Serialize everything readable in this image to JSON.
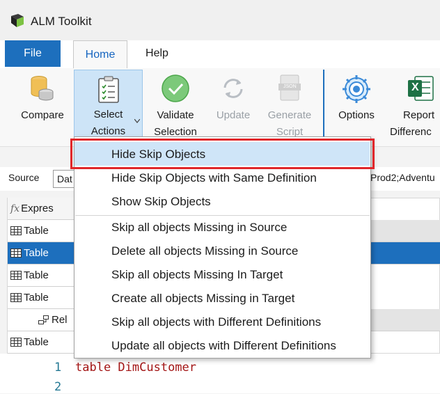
{
  "window": {
    "title": "ALM Toolkit"
  },
  "tabs": {
    "file": "File",
    "home": "Home",
    "help": "Help"
  },
  "ribbon": {
    "compare": "Compare",
    "select_actions_line1": "Select",
    "select_actions_line2": "Actions",
    "validate_line1": "Validate",
    "validate_line2": "Selection",
    "update": "Update",
    "generate_line1": "Generate",
    "generate_line2": "Script",
    "options": "Options",
    "report_line1": "Report",
    "report_line2": "Differenc",
    "json_icon_text": "JSON",
    "excel_icon_text": "X"
  },
  "source": {
    "label": "Source",
    "value": "Dat",
    "target_value": "Prod2;Adventu"
  },
  "grid": {
    "rows": [
      {
        "text": "Expres",
        "icon": "fx-icon",
        "selected": false
      },
      {
        "text": "Table",
        "icon": "table-icon",
        "selected": false
      },
      {
        "text": "Table",
        "icon": "table-icon",
        "selected": true
      },
      {
        "text": "Table",
        "icon": "table-icon",
        "selected": false
      },
      {
        "text": "Table",
        "icon": "table-icon",
        "selected": false
      },
      {
        "text": "Rel",
        "icon": "relationship-icon",
        "selected": false
      },
      {
        "text": "Table",
        "icon": "table-icon",
        "selected": false
      }
    ],
    "fx_symbol": "fx"
  },
  "code": {
    "line1_num": "1",
    "line1_keyword": "table ",
    "line1_ident": "DimCustomer",
    "line2_num": "2"
  },
  "menu": {
    "items": [
      "Hide Skip Objects",
      "Hide Skip Objects with Same Definition",
      "Show Skip Objects",
      "Skip all objects Missing in Source",
      "Delete all objects Missing in Source",
      "Skip all objects Missing In Target",
      "Create all objects Missing in Target",
      "Skip all objects with Different Definitions",
      "Update all objects with Different Definitions"
    ],
    "highlighted_index": 0
  },
  "colors": {
    "accent": "#1d6fbd",
    "highlight": "#cfe5f8",
    "annotation_red": "#e0262a",
    "code_keyword": "#a31515"
  }
}
